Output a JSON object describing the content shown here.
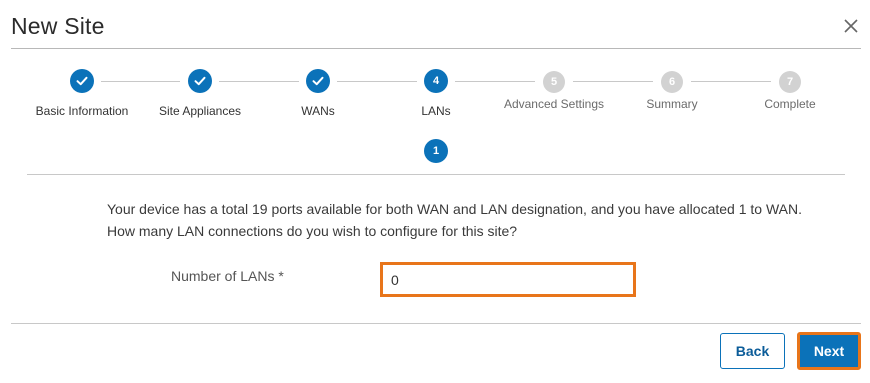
{
  "dialog": {
    "title": "New Site",
    "close_icon": "close-icon"
  },
  "stepper": {
    "steps": [
      {
        "label": "Basic Information",
        "number": "1",
        "state": "done"
      },
      {
        "label": "Site Appliances",
        "number": "2",
        "state": "done"
      },
      {
        "label": "WANs",
        "number": "3",
        "state": "done"
      },
      {
        "label": "LANs",
        "number": "4",
        "state": "active"
      },
      {
        "label": "Advanced Settings",
        "number": "5",
        "state": "pending"
      },
      {
        "label": "Summary",
        "number": "6",
        "state": "pending"
      },
      {
        "label": "Complete",
        "number": "7",
        "state": "pending"
      }
    ],
    "sub_step": "1",
    "colors": {
      "active": "#0b72b9",
      "pending": "#d2d2d2"
    }
  },
  "content": {
    "line1": "Your device has a total 19 ports available for both WAN and LAN designation, and you have allocated 1 to WAN.",
    "line2": "How many LAN connections do you wish to configure for this site?",
    "field_label": "Number of LANs *",
    "field_value": "0"
  },
  "footer": {
    "back_label": "Back",
    "next_label": "Next"
  },
  "highlight_color": "#e8751a"
}
